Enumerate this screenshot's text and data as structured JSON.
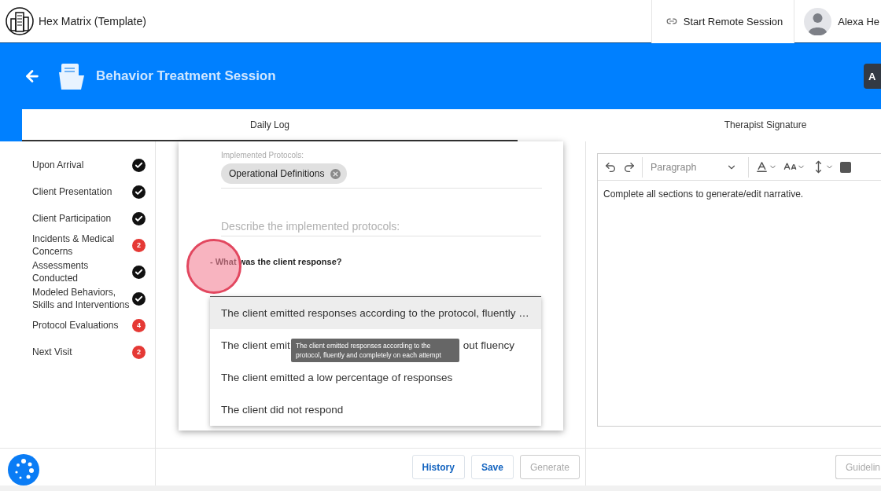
{
  "app": {
    "title": "Hex Matrix (Template)",
    "remote_session": "Start Remote Session",
    "user_name": "Alexa He"
  },
  "header": {
    "title": "Behavior Treatment Session",
    "action_button": "A"
  },
  "tabs": [
    {
      "label": "Daily Log",
      "selected": true
    },
    {
      "label": "Therapist Signature",
      "selected": false
    }
  ],
  "sidebar": {
    "items": [
      {
        "label": "Upon Arrival",
        "kind": "done"
      },
      {
        "label": "Client Presentation",
        "kind": "done"
      },
      {
        "label": "Client Participation",
        "kind": "done"
      },
      {
        "label": "Incidents & Medical Concerns",
        "kind": "count",
        "count": "2"
      },
      {
        "label": "Assessments Conducted",
        "kind": "done"
      },
      {
        "label": "Modeled Behaviors, Skills and Interventions",
        "kind": "done"
      },
      {
        "label": "Protocol Evaluations",
        "kind": "count",
        "count": "4"
      },
      {
        "label": "Next Visit",
        "kind": "count",
        "count": "2"
      }
    ]
  },
  "form": {
    "protocols_label": "Implemented Protocols:",
    "chips": [
      "Operational Definitions"
    ],
    "describe_placeholder": "Describe the implemented protocols:",
    "question": "- What was the client response?",
    "options": [
      {
        "text": "The client emitted responses according to the protocol, fluently …",
        "selected": true
      },
      {
        "text": "The client emit",
        "text_after": "out fluency",
        "selected": false
      },
      {
        "text": "The client emitted a low percentage of responses",
        "selected": false
      },
      {
        "text": "The client did not respond",
        "selected": false
      }
    ],
    "tooltip": "The client emitted responses according to the protocol, fluently and completely on each attempt"
  },
  "editor": {
    "block_format": "Paragraph",
    "placeholder": "Complete all sections to generate/edit narrative."
  },
  "footer": {
    "buttons": [
      {
        "label": "History",
        "disabled": false
      },
      {
        "label": "Save",
        "disabled": false
      },
      {
        "label": "Generate",
        "disabled": true
      }
    ],
    "right_buttons": [
      {
        "label": "Guidelin",
        "disabled": true
      }
    ]
  }
}
